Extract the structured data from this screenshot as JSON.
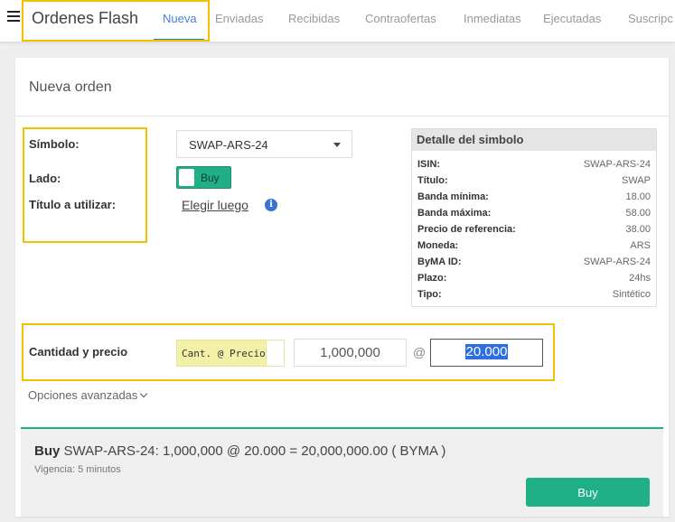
{
  "app": {
    "title": "Ordenes Flash"
  },
  "nav": {
    "tabs": [
      {
        "label": "Nueva",
        "active": true
      },
      {
        "label": "Enviadas"
      },
      {
        "label": "Recibidas"
      },
      {
        "label": "Contraofertas"
      },
      {
        "label": "Inmediatas"
      },
      {
        "label": "Ejecutadas"
      },
      {
        "label": "Suscripc"
      }
    ]
  },
  "form": {
    "title": "Nueva orden",
    "simbolo_label": "Símbolo:",
    "simbolo_value": "SWAP-ARS-24",
    "lado_label": "Lado:",
    "lado_value": "Buy",
    "titulo_label": "Título a utilizar:",
    "titulo_link": "Elegir luego",
    "info_icon": "i",
    "cantidad_label": "Cantidad y precio",
    "mode_label": "Cant. @ Precio:",
    "quantity": "1,000,000",
    "at": "@",
    "price": "20.000",
    "advanced": "Opciones avanzadas"
  },
  "detail": {
    "title": "Detalle del simbolo",
    "rows": [
      {
        "k": "ISIN:",
        "v": "SWAP-ARS-24"
      },
      {
        "k": "Título:",
        "v": "SWAP"
      },
      {
        "k": "Banda mínima:",
        "v": "18.00"
      },
      {
        "k": "Banda máxima:",
        "v": "58.00"
      },
      {
        "k": "Precio de referencia:",
        "v": "38.00"
      },
      {
        "k": "Moneda:",
        "v": "ARS"
      },
      {
        "k": "ByMA ID:",
        "v": "SWAP-ARS-24"
      },
      {
        "k": "Plazo:",
        "v": "24hs"
      },
      {
        "k": "Tipo:",
        "v": "Sintético"
      }
    ]
  },
  "summary": {
    "side": "Buy",
    "text": "SWAP-ARS-24: 1,000,000 @ 20.000 = 20,000,000.00 ( BYMA )",
    "vigencia": "Vigencia: 5 minutos",
    "button": "Buy"
  },
  "colors": {
    "accent": "#1fb088",
    "highlight": "#f2c200",
    "link": "#4a7fd6"
  }
}
